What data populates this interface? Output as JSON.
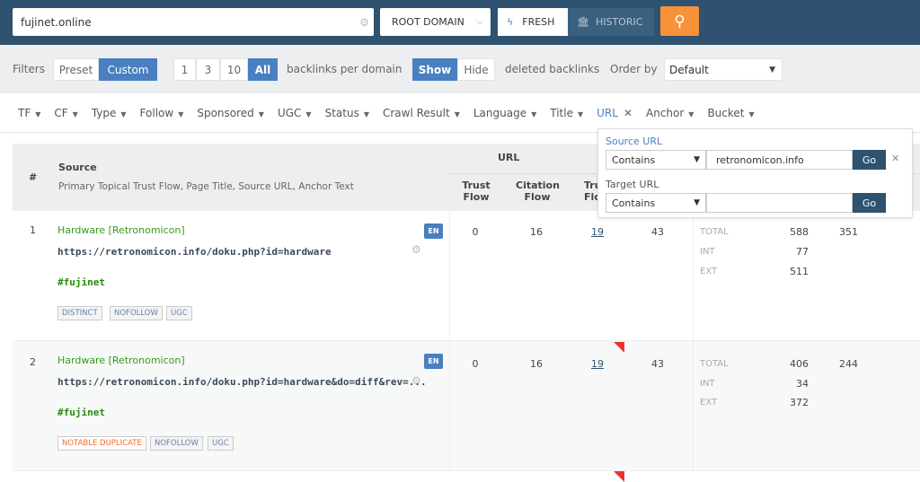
{
  "search": {
    "value": "fujinet.online",
    "scope": "ROOT DOMAIN",
    "fresh": "FRESH",
    "historic": "HISTORIC"
  },
  "filters": {
    "label": "Filters",
    "preset": "Preset",
    "custom": "Custom",
    "per_domain": [
      "1",
      "3",
      "10",
      "All"
    ],
    "per_domain_label": "backlinks per domain",
    "show": "Show",
    "hide": "Hide",
    "deleted_label": "deleted backlinks",
    "order_label": "Order by",
    "order_value": "Default"
  },
  "tabs": [
    "TF",
    "CF",
    "Type",
    "Follow",
    "Sponsored",
    "UGC",
    "Status",
    "Crawl Result",
    "Language",
    "Title",
    "URL",
    "Anchor",
    "Bucket"
  ],
  "table": {
    "hash": "#",
    "source": "Source",
    "source_sub": "Primary Topical Trust Flow, Page Title, Source URL, Anchor Text",
    "url_group": "URL",
    "trust_flow": "Trust Flow",
    "citation_flow": "Citation Flow",
    "tru_flo": "Tru Flo",
    "rows": [
      {
        "n": "1",
        "title": "Hardware [Retronomicon]",
        "url": "https://retronomicon.info/doku.php?id=hardware",
        "anchor": "#fujinet",
        "lang": "EN",
        "badges": [
          "DISTINCT",
          "NOFOLLOW",
          "UGC"
        ],
        "tf": "0",
        "cf": "16",
        "ttf": "19",
        "c4": "43",
        "total_label": "TOTAL",
        "total": "588",
        "int_label": "INT",
        "int": "77",
        "ext_label": "EXT",
        "ext": "511",
        "last": "351"
      },
      {
        "n": "2",
        "title": "Hardware [Retronomicon]",
        "url": "https://retronomicon.info/doku.php?id=hardware&do=diff&rev=...",
        "anchor": "#fujinet",
        "lang": "EN",
        "badges": [
          "NOTABLE DUPLICATE",
          "NOFOLLOW",
          "UGC"
        ],
        "tf": "0",
        "cf": "16",
        "ttf": "19",
        "c4": "43",
        "total_label": "TOTAL",
        "total": "406",
        "int_label": "INT",
        "int": "34",
        "ext_label": "EXT",
        "ext": "372",
        "last": "244"
      }
    ]
  },
  "popup": {
    "source_label": "Source URL",
    "source_op": "Contains",
    "source_value": "retronomicon.info",
    "target_label": "Target URL",
    "target_op": "Contains",
    "target_value": "",
    "go": "Go"
  },
  "colors": {
    "topbar": "#2e5270",
    "accent": "#4a7fc1",
    "search_button": "#f7923a"
  }
}
